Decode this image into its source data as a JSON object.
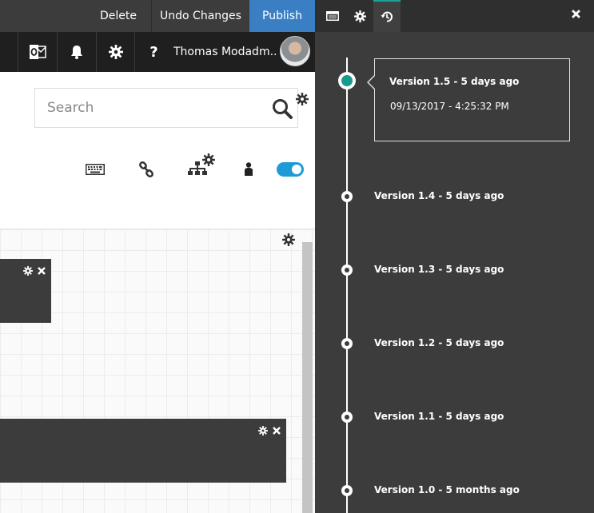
{
  "admin_bar": {
    "delete_label": "Delete",
    "undo_label": "Undo Changes",
    "publish_label": "Publish"
  },
  "header": {
    "user_name": "Thomas Modadm...",
    "icons": [
      "outlook-icon",
      "bell-icon",
      "gear-icon",
      "question-icon"
    ],
    "help_glyph": "?"
  },
  "search": {
    "placeholder": "Search"
  },
  "toolbar": {
    "icons": [
      "keyboard-icon",
      "link-icon",
      "sitemap-gear-icon",
      "person-icon"
    ],
    "toggle_on": true
  },
  "panel": {
    "tabs": [
      "list-icon",
      "gear-icon",
      "history-icon"
    ],
    "active_tab": "history-icon",
    "popup": {
      "title": "Version 1.5 - 5 days ago",
      "date": "09/13/2017 - 4:25:32 PM"
    },
    "versions": [
      {
        "label": "Version 1.5 - 5 days ago"
      },
      {
        "label": "Version 1.4 - 5 days ago"
      },
      {
        "label": "Version 1.3 - 5 days ago"
      },
      {
        "label": "Version 1.2 - 5 days ago"
      },
      {
        "label": "Version 1.1 - 5 days ago"
      },
      {
        "label": "Version 1.0 - 5 months ago"
      }
    ]
  },
  "colors": {
    "publish": "#3a7fc4",
    "accent_teal": "#1a9a8f",
    "toggle_blue": "#1e9bd7",
    "dark_bg": "#3c3c3c"
  }
}
